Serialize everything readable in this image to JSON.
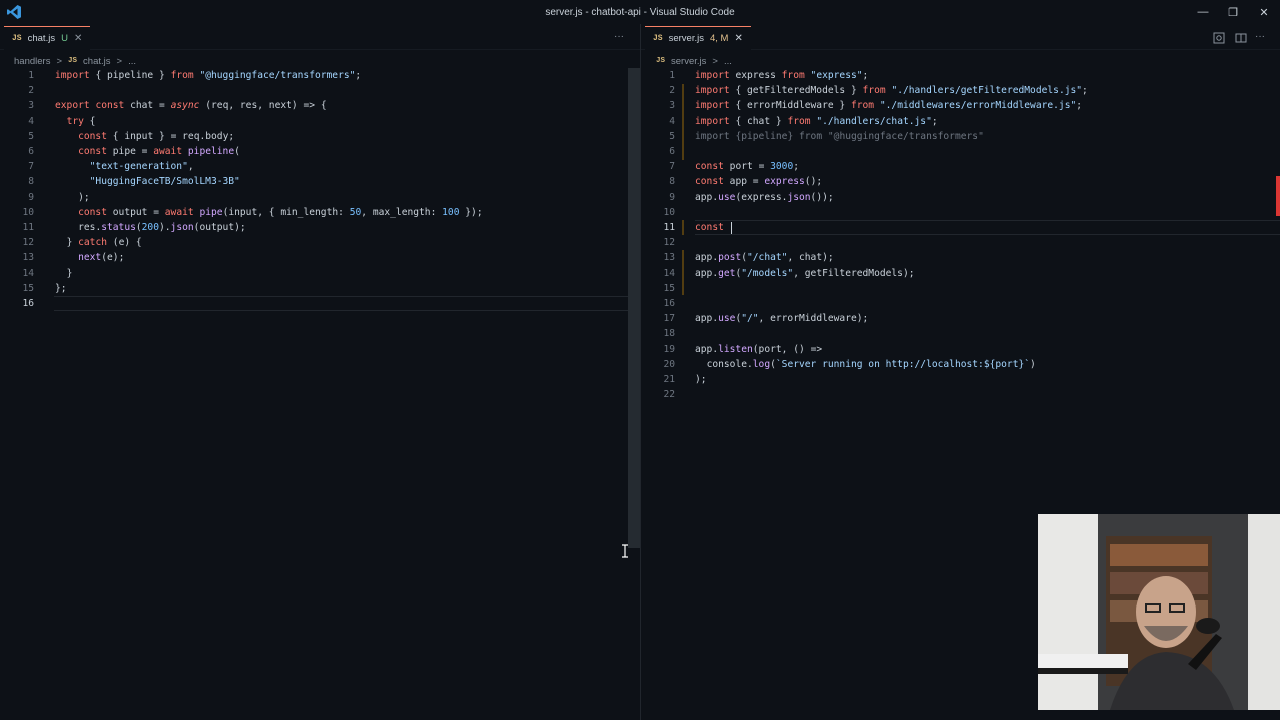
{
  "window": {
    "title": "server.js - chatbot-api - Visual Studio Code",
    "controls": [
      "—",
      "❐",
      "✕"
    ]
  },
  "left": {
    "tab": {
      "icon": "JS",
      "name": "chat.js",
      "status": "U",
      "close": "✕"
    },
    "more": "···",
    "breadcrumb": [
      "handlers",
      ">",
      "JS",
      "chat.js",
      ">",
      "..."
    ],
    "lines": [
      "import { pipeline } from \"@huggingface/transformers\";",
      "",
      "export const chat = async (req, res, next) => {",
      "  try {",
      "    const { input } = req.body;",
      "    const pipe = await pipeline(",
      "      \"text-generation\",",
      "      \"HuggingFaceTB/SmolLM3-3B\"",
      "    );",
      "    const output = await pipe(input, { min_length: 50, max_length: 100 });",
      "    res.status(200).json(output);",
      "  } catch (e) {",
      "    next(e);",
      "  }",
      "};",
      ""
    ]
  },
  "right": {
    "tab": {
      "icon": "JS",
      "name": "server.js",
      "status": "4, M",
      "close": "✕"
    },
    "breadcrumb": [
      "JS",
      "server.js",
      ">",
      "..."
    ],
    "lines": [
      "import express from \"express\";",
      "import { getFilteredModels } from \"./handlers/getFilteredModels.js\";",
      "import { errorMiddleware } from \"./middlewares/errorMiddleware.js\";",
      "import { chat } from \"./handlers/chat.js\";",
      "import {pipeline} from \"@huggingface/transformers\"",
      "",
      "const port = 3000;",
      "const app = express();",
      "app.use(express.json());",
      "",
      "const ",
      "",
      "app.post(\"/chat\", chat);",
      "app.get(\"/models\", getFilteredModels);",
      "",
      "",
      "app.use(\"/\", errorMiddleware);",
      "",
      "app.listen(port, () =>",
      "  console.log(`Server running on http://localhost:${port}`)",
      ");",
      ""
    ]
  },
  "colors": {
    "background": "#0d1117",
    "keyword": "#ff7b72",
    "string": "#a5d6ff",
    "function": "#d2a8ff",
    "number": "#79c0ff",
    "variable": "#ffa657"
  },
  "icons": {
    "app": "vscode-icon",
    "split": "split-editor-icon",
    "search": "search-icon"
  }
}
